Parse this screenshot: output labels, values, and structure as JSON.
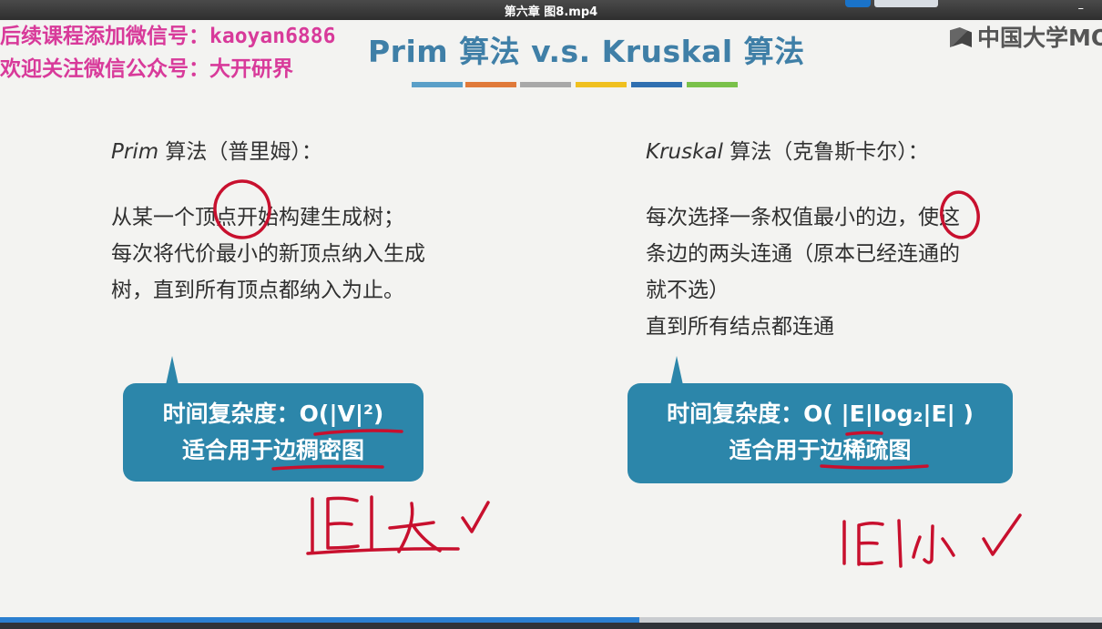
{
  "player": {
    "video_title": "第六章 图8.mp4",
    "minimize_glyph": "–",
    "progress_fraction": 0.58,
    "accent_color": "#2b7fd0"
  },
  "watermark": {
    "line1": "后续课程添加微信号：kaoyan6886",
    "line2": "欢迎关注微信公众号：大开研界",
    "color": "#d83a9a"
  },
  "logo": {
    "text": "中国大学MO",
    "icon": "mooc-book-icon"
  },
  "slide": {
    "title": "Prim 算法 v.s. Kruskal 算法",
    "title_color": "#3f7fa7",
    "color_bars": [
      "#5a9fc8",
      "#e07a3a",
      "#a8a8a8",
      "#f0c020",
      "#2f6fb0",
      "#7ac14a"
    ],
    "prim": {
      "heading_italic": "Prim",
      "heading_rest": " 算法（普里姆）：",
      "lines": [
        "从某一个顶点开始构建生成树；",
        "每次将代价最小的新顶点纳入生成",
        "树，直到所有顶点都纳入为止。"
      ],
      "bubble_line1": "时间复杂度：O(|V|²)",
      "bubble_line2": "适合用于边稠密图"
    },
    "kruskal": {
      "heading_italic": "Kruskal",
      "heading_rest": " 算法（克鲁斯卡尔）：",
      "lines": [
        "每次选择一条权值最小的边，使这",
        "条边的两头连通（原本已经连通的",
        "就不选）",
        "直到所有结点都连通"
      ],
      "bubble_line1": "时间复杂度：O( |E|log₂|E| )",
      "bubble_line2": "适合用于边稀疏图"
    },
    "bubble_color": "#2c86aa",
    "ink_color": "#c8102e"
  }
}
